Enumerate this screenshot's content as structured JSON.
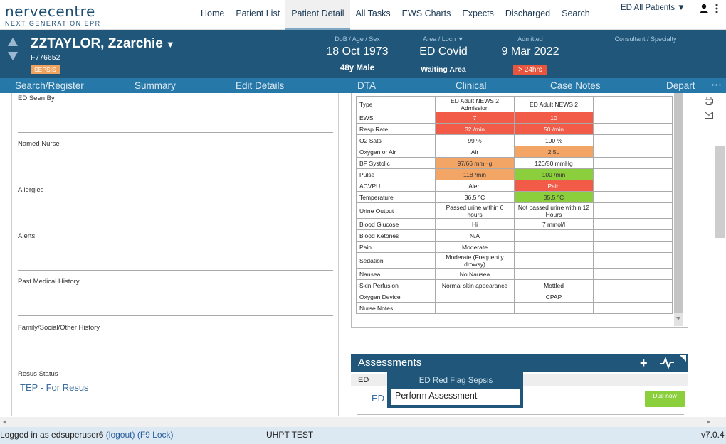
{
  "logo": {
    "main": "nervecentre",
    "sub": "NEXT GENERATION EPR"
  },
  "nav": {
    "items": [
      {
        "label": "Home"
      },
      {
        "label": "Patient List"
      },
      {
        "label": "Patient Detail"
      },
      {
        "label": "All Tasks"
      },
      {
        "label": "EWS Charts"
      },
      {
        "label": "Expects"
      },
      {
        "label": "Discharged"
      },
      {
        "label": "Search"
      }
    ],
    "ward": "ED All Patients ▼"
  },
  "patient": {
    "name": "ZZTAYLOR, Zzarchie",
    "caret": "▼",
    "id": "F776652",
    "badge": "SEPSIS",
    "dob_label": "DoB / Age / Sex",
    "dob": "18 Oct 1973",
    "age_sex": "48y Male",
    "area_label": "Area / Locn  ▼",
    "area": "ED Covid",
    "location": "Waiting Area",
    "admitted_label": "Admitted",
    "admitted": "9 Mar 2022",
    "los": "> 24hrs",
    "consultant_label": "Consultant / Specialty"
  },
  "subnav": {
    "items": [
      "Search/Register",
      "Summary",
      "Edit Details",
      "DTA",
      "Clinical",
      "Case Notes",
      "Depart"
    ],
    "more": "⋯"
  },
  "form": {
    "fields": [
      {
        "label": "ED Seen By",
        "value": ""
      },
      {
        "label": "Named Nurse",
        "value": ""
      },
      {
        "label": "Allergies",
        "value": ""
      },
      {
        "label": "Alerts",
        "value": ""
      },
      {
        "label": "Past Medical History",
        "value": ""
      },
      {
        "label": "Family/Social/Other History",
        "value": ""
      },
      {
        "label": "Resus Status",
        "value": "TEP - For Resus"
      }
    ]
  },
  "obs_table": {
    "rows": [
      {
        "label": "Type",
        "c1": "ED Adult NEWS 2 Admission",
        "c2": "ED Adult NEWS 2",
        "s1": "",
        "s2": ""
      },
      {
        "label": "EWS",
        "c1": "7",
        "c2": "10",
        "s1": "red",
        "s2": "red"
      },
      {
        "label": "Resp Rate",
        "c1": "32 /min",
        "c2": "50 /min",
        "s1": "red",
        "s2": "red"
      },
      {
        "label": "O2 Sats",
        "c1": "99 %",
        "c2": "100 %",
        "s1": "",
        "s2": ""
      },
      {
        "label": "Oxygen or Air",
        "c1": "Air",
        "c2": "2.5L",
        "s1": "",
        "s2": "orange"
      },
      {
        "label": "BP Systolic",
        "c1": "97/66 mmHg",
        "c2": "120/80 mmHg",
        "s1": "orange",
        "s2": ""
      },
      {
        "label": "Pulse",
        "c1": "118 /min",
        "c2": "100 /min",
        "s1": "orange",
        "s2": "green"
      },
      {
        "label": "ACVPU",
        "c1": "Alert",
        "c2": "Pain",
        "s1": "",
        "s2": "red"
      },
      {
        "label": "Temperature",
        "c1": "36.5 °C",
        "c2": "35.5 °C",
        "s1": "",
        "s2": "green"
      },
      {
        "label": "Urine Output",
        "c1": "Passed urine within 6 hours",
        "c2": "Not passed urine within 12 Hours",
        "s1": "",
        "s2": ""
      },
      {
        "label": "Blood Glucose",
        "c1": "Hi",
        "c2": "7 mmol/l",
        "s1": "",
        "s2": ""
      },
      {
        "label": "Blood Ketones",
        "c1": "N/A",
        "c2": "",
        "s1": "",
        "s2": ""
      },
      {
        "label": "Pain",
        "c1": "Moderate",
        "c2": "",
        "s1": "",
        "s2": ""
      },
      {
        "label": "Sedation",
        "c1": "Moderate (Frequently drowsy)",
        "c2": "",
        "s1": "",
        "s2": ""
      },
      {
        "label": "Nausea",
        "c1": "No Nausea",
        "c2": "",
        "s1": "",
        "s2": ""
      },
      {
        "label": "Skin Perfusion",
        "c1": "Normal skin appearance",
        "c2": "Mottled",
        "s1": "",
        "s2": ""
      },
      {
        "label": "Oxygen Device",
        "c1": "",
        "c2": "CPAP",
        "s1": "",
        "s2": ""
      },
      {
        "label": "Nurse Notes",
        "c1": "",
        "c2": "",
        "s1": "",
        "s2": ""
      }
    ]
  },
  "assessments": {
    "title": "Assessments",
    "plus": "+",
    "section": "ED",
    "item": "ED",
    "due": "Due now"
  },
  "popup": {
    "title": "ED Red Flag Sepsis",
    "action": "Perform Assessment"
  },
  "status": {
    "logged_in": "Logged in as edsuperuser6",
    "logout": "(logout)",
    "lock": "(F9 Lock)",
    "site": "UHPT TEST",
    "version": "v7.0.4"
  },
  "colors": {
    "banner": "#1f5679",
    "subnav": "#2678a8",
    "red": "#f15b47",
    "orange": "#f3a566",
    "green": "#8ccf3c"
  }
}
